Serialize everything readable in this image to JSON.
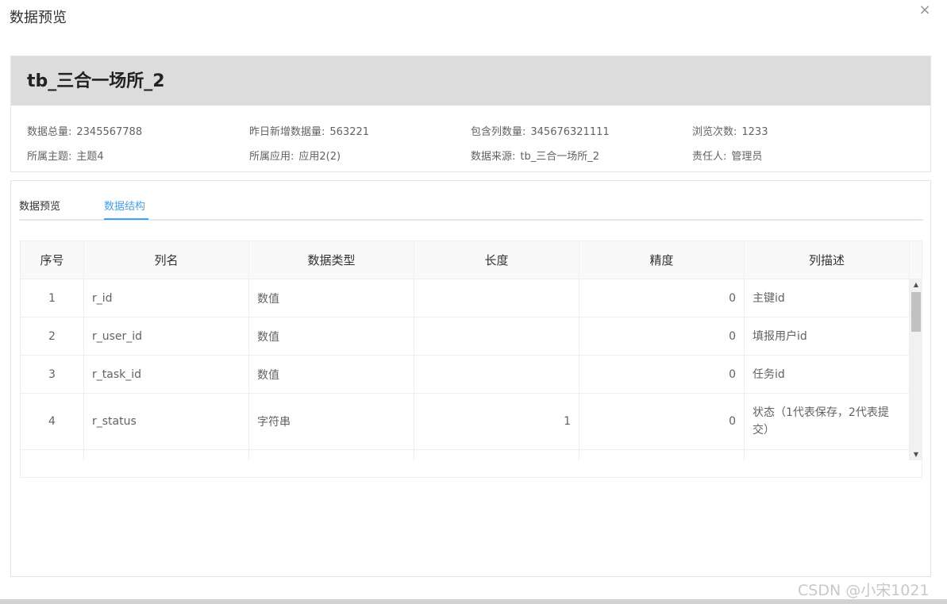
{
  "dialog": {
    "title": "数据预览",
    "close_icon": "×"
  },
  "info": {
    "table_name": "tb_三合一场所_2",
    "items": [
      {
        "label": "数据总量:",
        "value": "2345567788"
      },
      {
        "label": "昨日新增数据量:",
        "value": "563221"
      },
      {
        "label": "包含列数量:",
        "value": "345676321111"
      },
      {
        "label": "浏览次数:",
        "value": "1233"
      },
      {
        "label": "所属主题:",
        "value": "主题4"
      },
      {
        "label": "所属应用:",
        "value": "应用2(2)"
      },
      {
        "label": "数据来源:",
        "value": "tb_三合一场所_2"
      },
      {
        "label": "责任人:",
        "value": "管理员"
      }
    ]
  },
  "tabs": [
    {
      "label": "数据预览",
      "active": false
    },
    {
      "label": "数据结构",
      "active": true
    }
  ],
  "table": {
    "headers": [
      "序号",
      "列名",
      "数据类型",
      "长度",
      "精度",
      "列描述"
    ],
    "rows": [
      {
        "no": "1",
        "name": "r_id",
        "type": "数值",
        "length": "",
        "precision": "0",
        "desc": "主键id"
      },
      {
        "no": "2",
        "name": "r_user_id",
        "type": "数值",
        "length": "",
        "precision": "0",
        "desc": "填报用户id"
      },
      {
        "no": "3",
        "name": "r_task_id",
        "type": "数值",
        "length": "",
        "precision": "0",
        "desc": "任务id"
      },
      {
        "no": "4",
        "name": "r_status",
        "type": "字符串",
        "length": "1",
        "precision": "0",
        "desc": "状态（1代表保存，2代表提交）"
      },
      {
        "no": "",
        "name": "",
        "type": "",
        "length": "",
        "precision": "",
        "desc": ""
      }
    ],
    "scroll_up_icon": "▲",
    "scroll_down_icon": "▼"
  },
  "watermark": "CSDN @小宋1021"
}
